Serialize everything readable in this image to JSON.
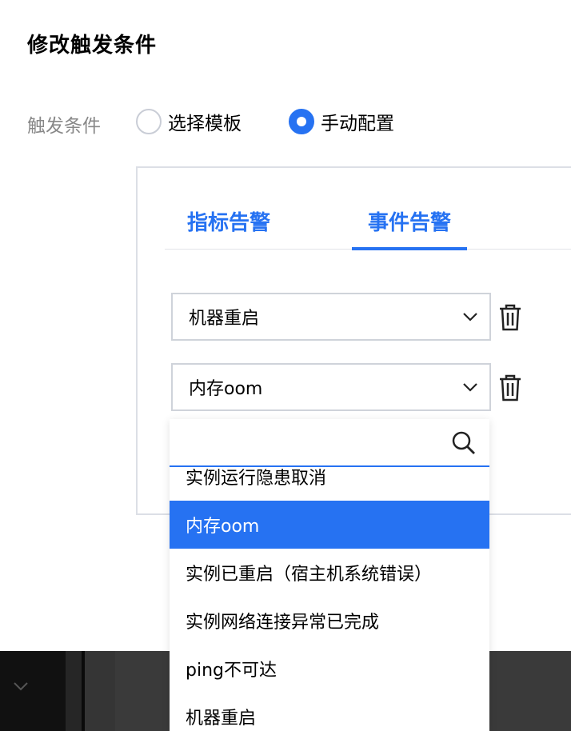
{
  "dialog": {
    "title": "修改触发条件"
  },
  "trigger": {
    "label": "触发条件",
    "options": [
      {
        "label": "选择模板",
        "checked": false
      },
      {
        "label": "手动配置",
        "checked": true
      }
    ]
  },
  "tabs": [
    {
      "label": "指标告警",
      "active": false
    },
    {
      "label": "事件告警",
      "active": true
    }
  ],
  "conditions": [
    {
      "value": "机器重启"
    },
    {
      "value": "内存oom"
    }
  ],
  "dropdown": {
    "search_value": "",
    "selected": "内存oom",
    "items": [
      "实例运行隐患取消",
      "内存oom",
      "实例已重启（宿主机系统错误）",
      "实例网络连接异常已完成",
      "ping不可达",
      "机器重启"
    ]
  },
  "colors": {
    "accent": "#2672f2",
    "muted_text": "#888888",
    "border": "#dcdfe6"
  }
}
